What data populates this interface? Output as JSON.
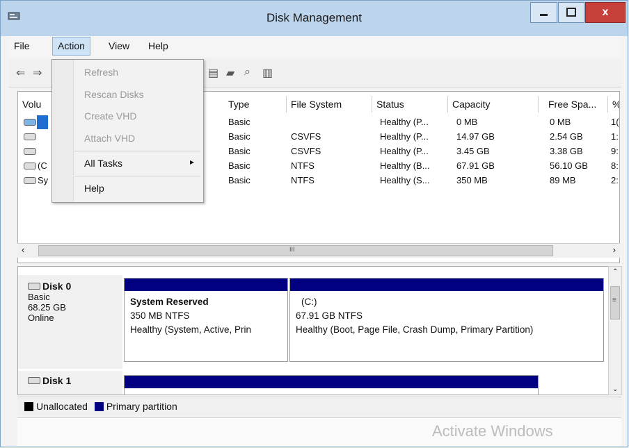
{
  "window": {
    "title": "Disk Management",
    "close_glyph": "x"
  },
  "menu": {
    "file": "File",
    "action": "Action",
    "view": "View",
    "help": "Help"
  },
  "action_menu": {
    "items": [
      {
        "label": "Refresh",
        "enabled": false
      },
      {
        "label": "Rescan Disks",
        "enabled": false
      },
      {
        "label": "Create VHD",
        "enabled": false
      },
      {
        "label": "Attach VHD",
        "enabled": false
      },
      {
        "label": "All Tasks",
        "enabled": true,
        "submenu": true
      },
      {
        "label": "Help",
        "enabled": true
      }
    ],
    "submenu_arrow": "▸"
  },
  "volume_list": {
    "columns": [
      "Volu",
      "Type",
      "File System",
      "Status",
      "Capacity",
      "Free Spa...",
      "%"
    ],
    "rows": [
      {
        "volume": "",
        "type": "Basic",
        "fs": "",
        "status": "Healthy (P...",
        "capacity": "0 MB",
        "free": "0 MB",
        "pct": "1("
      },
      {
        "volume": "",
        "type": "Basic",
        "fs": "CSVFS",
        "status": "Healthy (P...",
        "capacity": "14.97 GB",
        "free": "2.54 GB",
        "pct": "1:"
      },
      {
        "volume": "",
        "type": "Basic",
        "fs": "CSVFS",
        "status": "Healthy (P...",
        "capacity": "3.45 GB",
        "free": "3.38 GB",
        "pct": "9:"
      },
      {
        "volume": "(C",
        "type": "Basic",
        "fs": "NTFS",
        "status": "Healthy (B...",
        "capacity": "67.91 GB",
        "free": "56.10 GB",
        "pct": "8:"
      },
      {
        "volume": "Sy",
        "type": "Basic",
        "fs": "NTFS",
        "status": "Healthy (S...",
        "capacity": "350 MB",
        "free": "89 MB",
        "pct": "2:"
      }
    ],
    "scroll_center_glyph": "III"
  },
  "disks": [
    {
      "name": "Disk 0",
      "kind": "Basic",
      "size": "68.25 GB",
      "state": "Online",
      "partitions": [
        {
          "title": "System Reserved",
          "fs": "350 MB NTFS",
          "status": "Healthy (System, Active, Prin"
        },
        {
          "title": "(C:)",
          "fs": "67.91 GB NTFS",
          "status": "Healthy (Boot, Page File, Crash Dump, Primary Partition)"
        }
      ]
    },
    {
      "name": "Disk 1"
    }
  ],
  "legend": {
    "unallocated": "Unallocated",
    "primary": "Primary partition"
  },
  "watermark": "Activate Windows",
  "colors": {
    "primary_partition": "#000080",
    "unallocated": "#000000",
    "titlebar": "#bcd4ec",
    "close_button": "#c7413a"
  },
  "icons": [
    "disk-management-app-icon",
    "back-arrow-icon",
    "forward-arrow-icon",
    "properties-icon",
    "open-icon",
    "zoom-icon",
    "help-book-icon",
    "volume-icon",
    "disk-icon",
    "submenu-arrow-icon"
  ]
}
